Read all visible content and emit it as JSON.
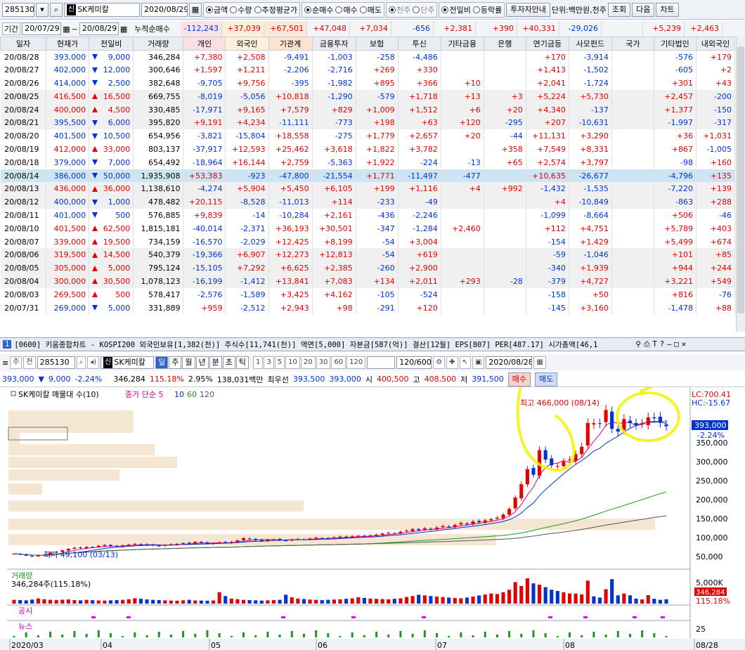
{
  "top_toolbar": {
    "stock_code": "285130",
    "stock_tag": "신",
    "stock_name": "SK케미칼",
    "date": "2020/08/29",
    "unit_options": [
      {
        "label": "금액",
        "on": true
      },
      {
        "label": "수량",
        "on": false
      },
      {
        "label": "추정평균가",
        "on": false
      }
    ],
    "trade_options": [
      {
        "label": "순매수",
        "on": true
      },
      {
        "label": "매수",
        "on": false
      },
      {
        "label": "매도",
        "on": false
      }
    ],
    "share_options": [
      {
        "label": "천주",
        "on": true
      },
      {
        "label": "단주",
        "on": false
      }
    ],
    "compare_options": [
      {
        "label": "전일비",
        "on": true
      },
      {
        "label": "등락률",
        "on": false
      }
    ],
    "investor_guide_btn": "투자자안내",
    "unit_text": "단위:백만원,천주",
    "search_btn": "조회",
    "next_btn": "다음",
    "chart_btn": "차트"
  },
  "period": {
    "label": "기간",
    "from": "20/07/29",
    "to": "20/08/29",
    "cumulative_label": "누적순매수",
    "sums": [
      "-112,243",
      "+37,039",
      "+67,501",
      "+47,048",
      "+7,034",
      "-656",
      "+2,381",
      "+390",
      "+40,331",
      "-29,026",
      "",
      "+5,239",
      "+2,463"
    ]
  },
  "table": {
    "headers": [
      "일자",
      "현재가",
      "전일비",
      "거래량",
      "개인",
      "외국인",
      "기관계",
      "금융투자",
      "보험",
      "투신",
      "기타금융",
      "은행",
      "연기금등",
      "사모펀드",
      "국가",
      "기타법인",
      "내외국인"
    ],
    "rows": [
      {
        "d": "20/08/28",
        "p": "393,000",
        "dir": "dn",
        "c": "9,000",
        "v": "346,284",
        "cells": [
          "+7,380",
          "+2,508",
          "-9,491",
          "-1,003",
          "-258",
          "-4,486",
          "",
          "",
          "+170",
          "-3,914",
          "",
          "-576",
          "+179"
        ]
      },
      {
        "d": "20/08/27",
        "p": "402,000",
        "dir": "dn",
        "c": "12,000",
        "v": "300,646",
        "cells": [
          "+1,597",
          "+1,211",
          "-2,206",
          "-2,716",
          "+269",
          "+330",
          "",
          "",
          "+1,413",
          "-1,502",
          "",
          "-605",
          "+2"
        ]
      },
      {
        "d": "20/08/26",
        "p": "414,000",
        "dir": "dn",
        "c": "2,500",
        "v": "382,648",
        "cells": [
          "-9,705",
          "+9,756",
          "-395",
          "-1,982",
          "+895",
          "+366",
          "+10",
          "",
          "+2,041",
          "-1,724",
          "",
          "+301",
          "+43"
        ]
      },
      {
        "d": "20/08/25",
        "p": "416,500",
        "dir": "up",
        "c": "16,500",
        "v": "669,755",
        "cells": [
          "-8,019",
          "-5,056",
          "+10,818",
          "-1,290",
          "-579",
          "+1,718",
          "+13",
          "+3",
          "+5,224",
          "+5,730",
          "",
          "+2,457",
          "-200"
        ]
      },
      {
        "d": "20/08/24",
        "p": "400,000",
        "dir": "up",
        "c": "4,500",
        "v": "330,485",
        "cells": [
          "-17,971",
          "+9,165",
          "+7,579",
          "+829",
          "+1,009",
          "+1,512",
          "+6",
          "+20",
          "+4,340",
          "-137",
          "",
          "+1,377",
          "-150"
        ]
      },
      {
        "d": "20/08/21",
        "p": "395,500",
        "dir": "dn",
        "c": "6,000",
        "v": "395,820",
        "cells": [
          "+9,191",
          "+4,234",
          "-11,111",
          "-773",
          "+198",
          "+63",
          "+120",
          "-295",
          "+207",
          "-10,631",
          "",
          "-1,997",
          "-317"
        ]
      },
      {
        "d": "20/08/20",
        "p": "401,500",
        "dir": "dn",
        "c": "10,500",
        "v": "654,956",
        "cells": [
          "-3,821",
          "-15,804",
          "+18,558",
          "-275",
          "+1,779",
          "+2,657",
          "+20",
          "-44",
          "+11,131",
          "+3,290",
          "",
          "+36",
          "+1,031"
        ]
      },
      {
        "d": "20/08/19",
        "p": "412,000",
        "dir": "up",
        "c": "33,000",
        "v": "803,137",
        "cells": [
          "-37,917",
          "+12,593",
          "+25,462",
          "+3,618",
          "+1,822",
          "+3,782",
          "",
          "+358",
          "+7,549",
          "+8,331",
          "",
          "+867",
          "-1,005"
        ]
      },
      {
        "d": "20/08/18",
        "p": "379,000",
        "dir": "dn",
        "c": "7,000",
        "v": "654,492",
        "cells": [
          "-18,964",
          "+16,144",
          "+2,759",
          "-5,363",
          "+1,922",
          "-224",
          "-13",
          "+65",
          "+2,574",
          "+3,797",
          "",
          "-98",
          "+160"
        ]
      },
      {
        "d": "20/08/14",
        "p": "386,000",
        "dir": "dn",
        "c": "50,000",
        "v": "1,935,908",
        "cells": [
          "+53,383",
          "-923",
          "-47,800",
          "-21,554",
          "+1,771",
          "-11,497",
          "-477",
          "",
          "+10,635",
          "-26,677",
          "",
          "-4,796",
          "+135"
        ]
      },
      {
        "d": "20/08/13",
        "p": "436,000",
        "dir": "up",
        "c": "36,000",
        "v": "1,138,610",
        "cells": [
          "-4,274",
          "+5,904",
          "+5,450",
          "+6,105",
          "+199",
          "+1,116",
          "+4",
          "+992",
          "-1,432",
          "-1,535",
          "",
          "-7,220",
          "+139"
        ]
      },
      {
        "d": "20/08/12",
        "p": "400,000",
        "dir": "dn",
        "c": "1,000",
        "v": "478,482",
        "cells": [
          "+20,115",
          "-8,528",
          "-11,013",
          "+114",
          "-233",
          "-49",
          "",
          "",
          "+4",
          "-10,849",
          "",
          "-863",
          "+288"
        ]
      },
      {
        "d": "20/08/11",
        "p": "401,000",
        "dir": "dn",
        "c": "500",
        "v": "576,885",
        "cells": [
          "+9,839",
          "-14",
          "-10,284",
          "+2,161",
          "-436",
          "-2,246",
          "",
          "",
          "-1,099",
          "-8,664",
          "",
          "+506",
          "-46"
        ]
      },
      {
        "d": "20/08/10",
        "p": "401,500",
        "dir": "up",
        "c": "62,500",
        "v": "1,815,181",
        "cells": [
          "-40,014",
          "-2,371",
          "+36,193",
          "+30,501",
          "-347",
          "-1,284",
          "+2,460",
          "",
          "+112",
          "+4,751",
          "",
          "+5,789",
          "+403"
        ]
      },
      {
        "d": "20/08/07",
        "p": "339,000",
        "dir": "up",
        "c": "19,500",
        "v": "734,159",
        "cells": [
          "-16,570",
          "-2,029",
          "+12,425",
          "+8,199",
          "-54",
          "+3,004",
          "",
          "",
          "-154",
          "+1,429",
          "",
          "+5,499",
          "+674"
        ]
      },
      {
        "d": "20/08/06",
        "p": "319,500",
        "dir": "up",
        "c": "14,500",
        "v": "540,379",
        "cells": [
          "-19,366",
          "+6,907",
          "+12,273",
          "+12,813",
          "-54",
          "+619",
          "",
          "",
          "-59",
          "-1,046",
          "",
          "+101",
          "+85"
        ]
      },
      {
        "d": "20/08/05",
        "p": "305,000",
        "dir": "up",
        "c": "5,000",
        "v": "795,124",
        "cells": [
          "-15,105",
          "+7,292",
          "+6,625",
          "+2,385",
          "-260",
          "+2,900",
          "",
          "",
          "-340",
          "+1,939",
          "",
          "+944",
          "+244"
        ]
      },
      {
        "d": "20/08/04",
        "p": "300,000",
        "dir": "up",
        "c": "30,500",
        "v": "1,078,123",
        "cells": [
          "-16,199",
          "-1,412",
          "+13,841",
          "+7,083",
          "+134",
          "+2,011",
          "+293",
          "-28",
          "-379",
          "+4,727",
          "",
          "+3,221",
          "+549"
        ]
      },
      {
        "d": "20/08/03",
        "p": "269,500",
        "dir": "up",
        "c": "500",
        "v": "578,417",
        "cells": [
          "-2,576",
          "-1,589",
          "+3,425",
          "+4,162",
          "-105",
          "-524",
          "",
          "",
          "-158",
          "+50",
          "",
          "+816",
          "-76"
        ]
      },
      {
        "d": "20/07/31",
        "p": "269,000",
        "dir": "dn",
        "c": "5,000",
        "v": "331,889",
        "cells": [
          "+959",
          "-2,512",
          "+2,943",
          "+98",
          "-291",
          "+120",
          "",
          "",
          "-145",
          "+3,160",
          "",
          "-1,478",
          "+88"
        ]
      }
    ]
  },
  "chart_window": {
    "num": "1",
    "title": "[0600] 키움종합차트 - KOSPI200 외국인보유[1,382(천)] 주식수[11,741(천)] 액면[5,000] 자본금[587(억)] 결산[12월] EPS[807] PER[487.17] 시가총액[46,1",
    "period_tabs": [
      "일",
      "주",
      "월",
      "년",
      "분",
      "초",
      "틱"
    ],
    "active_tab": "일",
    "minute_options": [
      "1",
      "3",
      "5",
      "10",
      "20",
      "30",
      "60",
      "120"
    ],
    "count": "120/600",
    "chart_date": "2020/08/28",
    "code": "285130",
    "name": "SK케미칼",
    "week_label": "주",
    "prev_label": "전"
  },
  "price_bar": {
    "price": "393,000",
    "change": "9,000",
    "rate": "-2.24%",
    "volume": "346,284",
    "vol_ratio": "115.18%",
    "turnover": "2.95%",
    "amount": "138,031백만",
    "best_ask_label": "최우선",
    "ask": "393,500",
    "bid": "393,000",
    "open_label": "시",
    "open": "400,500",
    "high_label": "고",
    "high": "408,500",
    "low_label": "저",
    "low": "391,500",
    "buy_btn": "매수",
    "sell_btn": "매도"
  },
  "chart_data": {
    "type": "candlestick",
    "legend": "SK케미칼 매물대 수(10)",
    "ma_label": "종가 단순",
    "ma_periods": [
      "5",
      "10",
      "60",
      "120"
    ],
    "ma_colors": [
      "#d0009a",
      "#0033cc",
      "#1a9a1a",
      "#555555"
    ],
    "max_label": "최고 466,000 (08/14)",
    "min_label": "최저 49,100 (03/13)",
    "lc_label": "LC:700.41",
    "hc_label": "HC:-15.67",
    "current_price_label": "393,000",
    "current_rate_label": "-2.24%",
    "ylim": [
      20000,
      470000
    ],
    "y_ticks": [
      50000,
      100000,
      150000,
      200000,
      250000,
      300000,
      350000
    ],
    "y_tick_labels": [
      "50,000",
      "100,000",
      "150,000",
      "200,000",
      "250,000",
      "300,000",
      "350,000"
    ],
    "x_labels": [
      "2020/03",
      "04",
      "05",
      "06",
      "07",
      "08",
      "08/28"
    ],
    "closes": [
      57000,
      55000,
      52000,
      50000,
      53000,
      54000,
      60000,
      62000,
      66000,
      70000,
      73000,
      72000,
      75000,
      74000,
      78000,
      80000,
      77000,
      76000,
      79000,
      81000,
      83000,
      82000,
      80000,
      79000,
      78000,
      80000,
      82000,
      83000,
      85000,
      84000,
      88000,
      86000,
      84000,
      85000,
      87000,
      86000,
      88000,
      92000,
      98000,
      96000,
      93000,
      91000,
      94000,
      95000,
      93000,
      92000,
      94000,
      96000,
      95000,
      97000,
      99000,
      98000,
      97000,
      100000,
      102000,
      101000,
      103000,
      104000,
      103000,
      105000,
      107000,
      110000,
      112000,
      111000,
      115000,
      118000,
      122000,
      119000,
      124000,
      121000,
      126000,
      130000,
      128000,
      133000,
      138000,
      135000,
      142000,
      140000,
      145000,
      148000,
      152000,
      160000,
      175000,
      205000,
      240000,
      280000,
      265000,
      330000,
      305000,
      290000,
      288000,
      300000,
      305000,
      319500,
      339000,
      401500,
      401000,
      400000,
      436000,
      386000,
      379000,
      412000,
      401500,
      395500,
      400000,
      416500,
      414000,
      402000,
      393000
    ],
    "volume_label": "거래량",
    "volume_text": "346,284주(115.18%)",
    "volume_scale": "5,000K",
    "volume_current": "346,284",
    "volume_rate": "115.18%",
    "volumes": [
      300,
      280,
      260,
      320,
      410,
      350,
      300,
      290,
      310,
      330,
      280,
      260,
      300,
      270,
      250,
      240,
      260,
      280,
      300,
      350,
      420,
      380,
      330,
      300,
      280,
      260,
      240,
      230,
      260,
      300,
      250,
      240,
      230,
      250,
      900,
      600,
      400,
      350,
      300,
      280,
      260,
      240,
      260,
      280,
      300,
      700,
      500,
      400,
      360,
      320,
      300,
      280,
      300,
      320,
      340,
      380,
      420,
      500,
      450,
      400,
      380,
      360,
      340,
      380,
      420,
      520,
      600,
      700,
      650,
      600,
      560,
      520,
      480,
      440,
      420,
      480,
      560,
      640,
      720,
      800,
      760,
      900,
      1100,
      1700,
      1400,
      2000,
      1600,
      1500,
      1300,
      1100,
      1000,
      900,
      800,
      795,
      734,
      1815,
      577,
      478,
      1139,
      1936,
      654,
      803,
      655,
      396,
      330,
      670,
      383,
      301,
      346
    ],
    "notice_label": "공시",
    "news_label": "뉴스",
    "news_scale": "25"
  }
}
